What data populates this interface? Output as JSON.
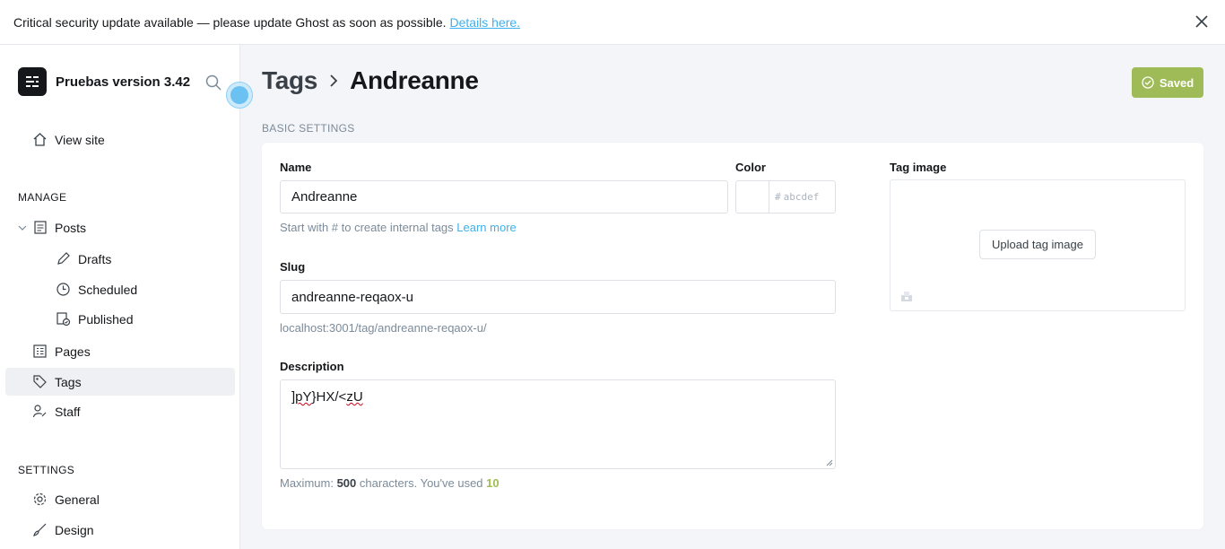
{
  "banner": {
    "message": "Critical security update available — please update Ghost as soon as possible.",
    "link": "Details here."
  },
  "sidebar": {
    "brand": "Pruebas version 3.42",
    "view_site": "View site",
    "manage_heading": "MANAGE",
    "items": {
      "posts": "Posts",
      "drafts": "Drafts",
      "scheduled": "Scheduled",
      "published": "Published",
      "pages": "Pages",
      "tags": "Tags",
      "staff": "Staff"
    },
    "settings_heading": "SETTINGS",
    "settings_items": {
      "general": "General",
      "design": "Design"
    }
  },
  "header": {
    "breadcrumb_parent": "Tags",
    "breadcrumb_current": "Andreanne",
    "saved_label": "Saved"
  },
  "form": {
    "section_title": "BASIC SETTINGS",
    "name_label": "Name",
    "name_value": "Andreanne",
    "name_hint": "Start with # to create internal tags",
    "name_hint_link": "Learn more",
    "color_label": "Color",
    "color_placeholder": "abcdef",
    "color_hash": "#",
    "slug_label": "Slug",
    "slug_value": "andreanne-reqaox-u",
    "slug_url": "localhost:3001/tag/andreanne-reqaox-u/",
    "description_label": "Description",
    "description_value": "]pY}HX/<zU",
    "description_parts": [
      "]",
      "pY",
      "}HX/<",
      "zU"
    ],
    "desc_hint_prefix": "Maximum:",
    "desc_max": "500",
    "desc_hint_mid": "characters. You've used",
    "desc_used": "10",
    "tag_image_label": "Tag image",
    "upload_label": "Upload tag image"
  },
  "colors": {
    "accent": "#3eb0ef",
    "saved": "#9fbb58",
    "used_count": "#9fbb58"
  }
}
